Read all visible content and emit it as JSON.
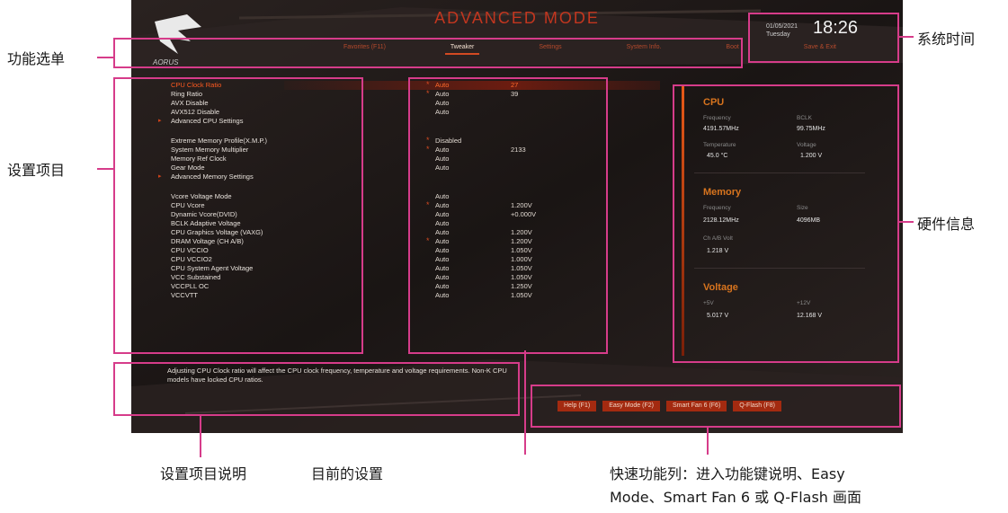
{
  "header": {
    "mode_title": "ADVANCED MODE",
    "logo_text": "AORUS"
  },
  "menu": {
    "items": [
      "Favorites (F11)",
      "Tweaker",
      "Settings",
      "System Info.",
      "Boot",
      "Save & Exit"
    ],
    "active": "Tweaker"
  },
  "clock": {
    "date": "01/05/2021",
    "day": "Tuesday",
    "time": "18:26"
  },
  "settings": {
    "items": [
      {
        "label": "CPU Clock Ratio",
        "value": "Auto",
        "value2": "27",
        "star": true,
        "selected": true
      },
      {
        "label": "Ring Ratio",
        "value": "Auto",
        "value2": "39",
        "star": true
      },
      {
        "label": "AVX Disable",
        "value": "Auto"
      },
      {
        "label": "AVX512 Disable",
        "value": "Auto"
      },
      {
        "label": "Advanced CPU Settings",
        "submenu": true
      },
      {
        "gap": true
      },
      {
        "label": "Extreme Memory Profile(X.M.P.)",
        "value": "Disabled",
        "star": true
      },
      {
        "label": "System Memory Multiplier",
        "value": "Auto",
        "value2": "2133",
        "star": true
      },
      {
        "label": "Memory Ref Clock",
        "value": "Auto"
      },
      {
        "label": "Gear Mode",
        "value": "Auto"
      },
      {
        "label": "Advanced Memory Settings",
        "submenu": true
      },
      {
        "gap": true
      },
      {
        "label": "Vcore Voltage Mode",
        "value": "Auto"
      },
      {
        "label": "CPU Vcore",
        "value": "Auto",
        "value2": "1.200V",
        "star": true
      },
      {
        "label": "Dynamic Vcore(DVID)",
        "value": "Auto",
        "value2": "+0.000V"
      },
      {
        "label": "BCLK Adaptive Voltage",
        "value": "Auto"
      },
      {
        "label": "CPU Graphics Voltage (VAXG)",
        "value": "Auto",
        "value2": "1.200V"
      },
      {
        "label": "DRAM Voltage    (CH A/B)",
        "value": "Auto",
        "value2": "1.200V",
        "star": true
      },
      {
        "label": "CPU VCCIO",
        "value": "Auto",
        "value2": "1.050V"
      },
      {
        "label": "CPU VCCIO2",
        "value": "Auto",
        "value2": "1.000V"
      },
      {
        "label": "CPU System Agent Voltage",
        "value": "Auto",
        "value2": "1.050V"
      },
      {
        "label": "VCC Substained",
        "value": "Auto",
        "value2": "1.050V"
      },
      {
        "label": "VCCPLL OC",
        "value": "Auto",
        "value2": "1.250V"
      },
      {
        "label": "VCCVTT",
        "value": "Auto",
        "value2": "1.050V"
      }
    ]
  },
  "hardware": {
    "cpu": {
      "title": "CPU",
      "freq_label": "Frequency",
      "freq": "4191.57MHz",
      "bclk_label": "BCLK",
      "bclk": "99.75MHz",
      "temp_label": "Temperature",
      "temp": "45.0 °C",
      "volt_label": "Voltage",
      "volt": "1.200 V"
    },
    "memory": {
      "title": "Memory",
      "freq_label": "Frequency",
      "freq": "2128.12MHz",
      "size_label": "Size",
      "size": "4096MB",
      "volt_label": "Ch A/B Volt",
      "volt": "1.218 V"
    },
    "voltage": {
      "title": "Voltage",
      "v5_label": "+5V",
      "v5": "5.017 V",
      "v12_label": "+12V",
      "v12": "12.168 V"
    }
  },
  "description": "Adjusting CPU Clock ratio will affect the CPU clock frequency, temperature and voltage requirements. Non-K CPU models have locked CPU ratios.",
  "quick_keys": [
    "Help (F1)",
    "Easy Mode (F2)",
    "Smart Fan 6 (F6)",
    "Q-Flash (F8)"
  ],
  "callouts": {
    "menu": "功能选单",
    "settings": "设置项目",
    "time": "系统时间",
    "hardware": "硬件信息",
    "desc": "设置项目说明",
    "current": "目前的设置",
    "quick_line1": "快速功能列：进入功能键说明、Easy",
    "quick_line2": "Mode、Smart Fan 6 或 Q-Flash 画面"
  },
  "colors": {
    "accent": "#d24a22",
    "frame": "#d63c8a",
    "panel": "#121010"
  }
}
